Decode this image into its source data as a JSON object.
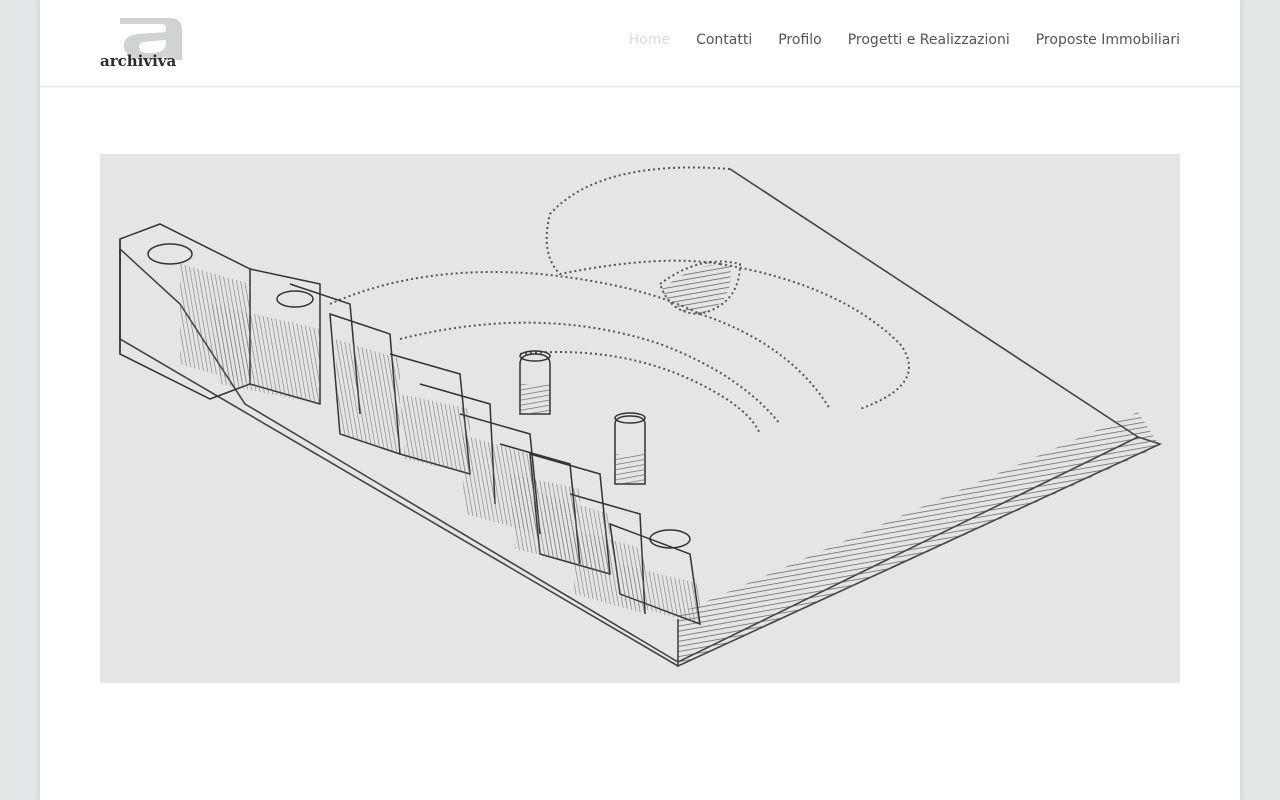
{
  "site": {
    "logo_text": "archiviva",
    "logo_icon": "letter-a-logo-icon"
  },
  "nav": {
    "items": [
      {
        "label": "Home",
        "active": true
      },
      {
        "label": "Contatti",
        "active": false
      },
      {
        "label": "Profilo",
        "active": false
      },
      {
        "label": "Progetti e Realizzazioni",
        "active": false
      },
      {
        "label": "Proposte Immobiliari",
        "active": false
      }
    ]
  },
  "hero": {
    "image": "pencil-sketch-3d-logo-illustration"
  },
  "colors": {
    "page_bg": "#e4e7e8",
    "content_bg": "#ffffff",
    "nav_text": "#555555",
    "nav_active": "#d9dcdd",
    "hero_bg": "#e5e5e5",
    "sketch_stroke": "#444444"
  }
}
